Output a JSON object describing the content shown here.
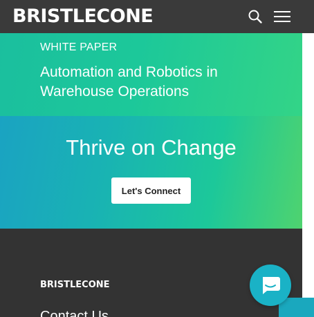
{
  "header": {
    "logo_text": "BRISTLECONE",
    "search_icon": "search-icon",
    "menu_icon": "hamburger-menu-icon"
  },
  "hero": {
    "eyebrow": "WHITE PAPER",
    "title": "Automation and Robotics in Warehouse Operations"
  },
  "cta": {
    "title": "Thrive on Change",
    "button_label": "Let's Connect"
  },
  "footer": {
    "logo_text": "BRISTLECONE",
    "heading": "Contact Us"
  },
  "chat": {
    "icon": "chat-bubble-icon",
    "color": "#1ab2c6"
  },
  "colors": {
    "header_bg": "#3a3a3a",
    "hero_gradient_start": "#1bbf9e",
    "hero_gradient_end": "#33d487",
    "cta_gradient_start": "#1aa3c2",
    "cta_gradient_end": "#4fd36f",
    "footer_bg": "#333333"
  }
}
